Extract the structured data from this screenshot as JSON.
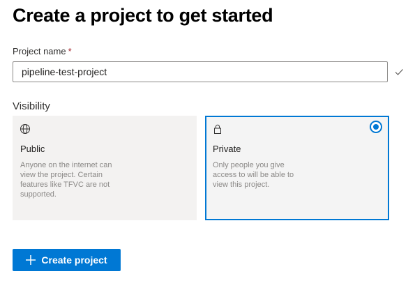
{
  "page": {
    "title": "Create a project to get started"
  },
  "project_name": {
    "label": "Project name",
    "required_mark": "*",
    "value": "pipeline-test-project",
    "valid_icon": "checkmark-icon"
  },
  "visibility": {
    "label": "Visibility",
    "selected": "Private",
    "options": [
      {
        "title": "Public",
        "icon": "globe-icon",
        "description": "Anyone on the internet can view the project. Certain features like TFVC are not supported."
      },
      {
        "title": "Private",
        "icon": "lock-icon",
        "description": "Only people you give access to will be able to view this project."
      }
    ]
  },
  "actions": {
    "create_label": "Create project",
    "create_icon": "plus-icon"
  },
  "colors": {
    "accent": "#0078d4",
    "card_bg": "#f3f2f1",
    "required": "#a4262c"
  }
}
